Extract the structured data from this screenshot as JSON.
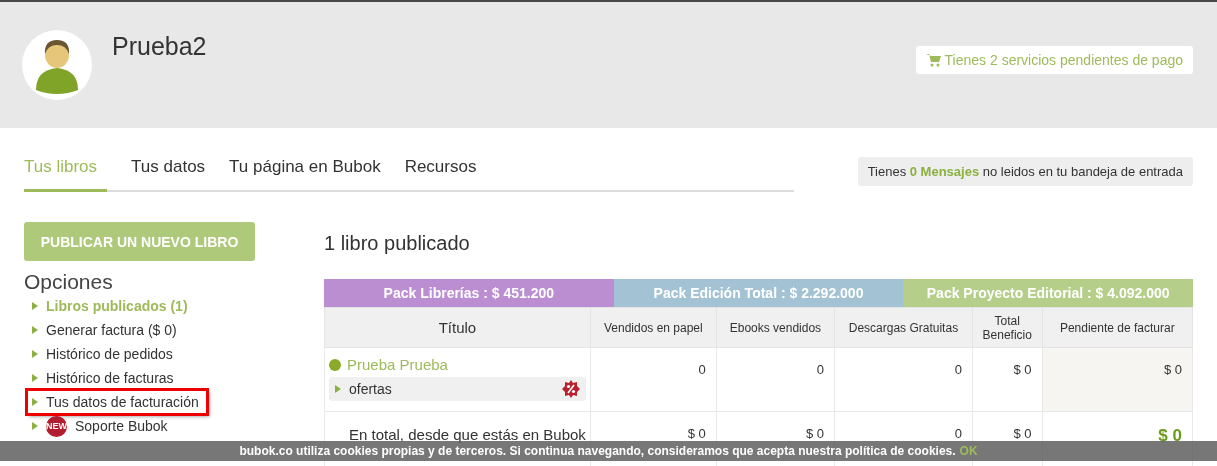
{
  "user": {
    "name": "Prueba2"
  },
  "pending_notice": "Tienes 2 servicios pendientes de pago",
  "tabs": [
    {
      "label": "Tus libros",
      "selected": true
    },
    {
      "label": "Tus datos",
      "selected": false
    },
    {
      "label": "Tu página en Bubok",
      "selected": false
    },
    {
      "label": "Recursos",
      "selected": false
    }
  ],
  "messages_notice": "Tienes **0 Mensajes** no leidos en tu bandeja de entrada",
  "publish_button": "PUBLICAR UN NUEVO LIBRO",
  "options": {
    "title": "Opciones",
    "items": [
      {
        "label": "Libros publicados (1)",
        "selected": true,
        "highlighted": false
      },
      {
        "label": "Generar factura ($ 0)",
        "selected": false,
        "highlighted": false
      },
      {
        "label": "Histórico de pedidos",
        "selected": false,
        "highlighted": false
      },
      {
        "label": "Histórico de facturas",
        "selected": false,
        "highlighted": false
      },
      {
        "label": "Tus datos de facturación",
        "selected": false,
        "highlighted": true
      },
      {
        "label": "Soporte Bubok",
        "selected": false,
        "highlighted": false,
        "badge": "NEW"
      }
    ]
  },
  "books_count": "1 libro publicado",
  "packs": [
    {
      "label": "Pack Librerías : $ 451.200",
      "color": "#bb8ed2"
    },
    {
      "label": "Pack Edición Total : $ 2.292.000",
      "color": "#a3c3d4"
    },
    {
      "label": "Pack Proyecto Editorial : $ 4.092.000",
      "color": "#b5cf8a"
    }
  ],
  "table": {
    "columns": [
      "Título",
      "Vendidos en papel",
      "Ebooks vendidos",
      "Descargas Gratuitas",
      "Total Beneficio",
      "Pendiente de facturar"
    ],
    "rows": [
      {
        "kind": "book",
        "sub_item": "ofertas",
        "cells": [
          "Prueba Prueba",
          "0",
          "0",
          "0",
          "$ 0",
          "$ 0"
        ]
      },
      {
        "kind": "total",
        "cells": [
          "En total, desde que estás en Bubok",
          "$ 0",
          "$ 0",
          "0",
          "$ 0",
          "$ 0"
        ]
      }
    ]
  },
  "cookie_bar": {
    "text": "bubok.co utiliza cookies propias y de terceros. Si continua navegando, consideramos que acepta nuestra política de cookies.",
    "action": "OK"
  }
}
